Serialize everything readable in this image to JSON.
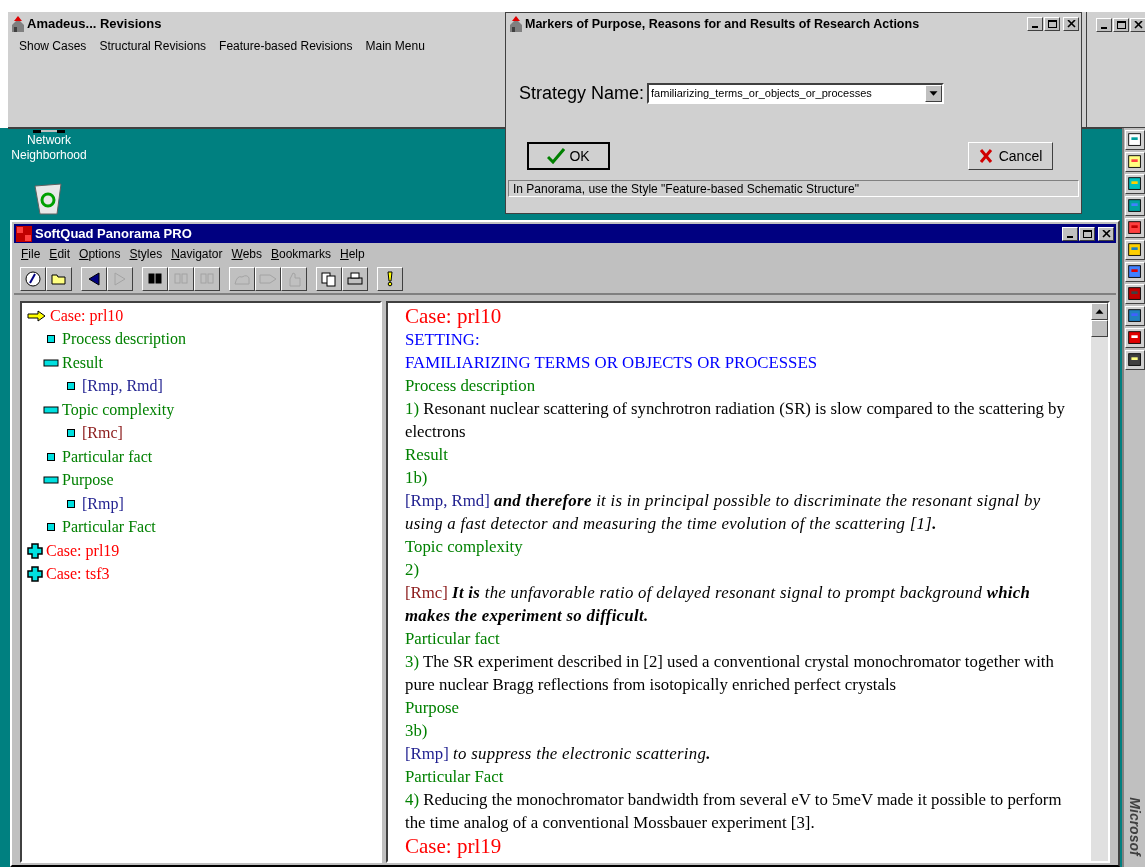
{
  "amadeus_window": {
    "title": "Amadeus... Revisions",
    "menu": [
      "Show Cases",
      "Structural Revisions",
      "Feature-based Revisions",
      "Main Menu"
    ]
  },
  "dialog": {
    "title": "Markers of Purpose, Reasons for and Results of Research Actions",
    "label": "Strategy Name:",
    "value": "familiarizing_terms_or_objects_or_processes",
    "ok": "OK",
    "cancel": "Cancel",
    "status": "In Panorama, use the Style \"Feature-based Schematic Structure\""
  },
  "desktop_icons": [
    {
      "label": "Network Neighborhood",
      "kind": "network"
    },
    {
      "kind": "recycle"
    }
  ],
  "side_bar_text": "Microsof",
  "panorama": {
    "title": "SoftQuad Panorama PRO",
    "menu": [
      "File",
      "Edit",
      "Options",
      "Styles",
      "Navigator",
      "Webs",
      "Bookmarks",
      "Help"
    ],
    "toolbar": [
      [
        {
          "kind": "help",
          "disabled": false
        },
        {
          "kind": "open",
          "disabled": false
        }
      ],
      [
        {
          "kind": "back",
          "disabled": false
        },
        {
          "kind": "forward",
          "disabled": true
        }
      ],
      [
        {
          "kind": "find",
          "disabled": false
        },
        {
          "kind": "find-prev",
          "disabled": true
        },
        {
          "kind": "find-next",
          "disabled": true
        }
      ],
      [
        {
          "kind": "web",
          "disabled": true
        },
        {
          "kind": "point",
          "disabled": true
        },
        {
          "kind": "thumb",
          "disabled": true
        }
      ],
      [
        {
          "kind": "copy",
          "disabled": false
        },
        {
          "kind": "print",
          "disabled": false
        }
      ],
      [
        {
          "kind": "alert",
          "disabled": false
        }
      ]
    ],
    "tree": [
      {
        "label": "Case: prl10",
        "kind": "case",
        "current": true,
        "expanded": true,
        "children": [
          {
            "label": "Process description",
            "kind": "section"
          },
          {
            "label": "Result",
            "kind": "section",
            "expanded": true,
            "children": [
              {
                "label": "[Rmp, Rmd]",
                "kind": "ref",
                "color": "#1f1f8f"
              }
            ]
          },
          {
            "label": "Topic complexity",
            "kind": "section",
            "expanded": true,
            "children": [
              {
                "label": "[Rmc]",
                "kind": "ref",
                "color": "#8b1a1a"
              }
            ]
          },
          {
            "label": "Particular fact",
            "kind": "section"
          },
          {
            "label": "Purpose",
            "kind": "section",
            "expanded": true,
            "children": [
              {
                "label": "[Rmp]",
                "kind": "ref",
                "color": "#1f1f8f"
              }
            ]
          },
          {
            "label": "Particular Fact",
            "kind": "section"
          }
        ]
      },
      {
        "label": "Case: prl19",
        "kind": "case",
        "current": false,
        "expanded": false
      },
      {
        "label": "Case: tsf3",
        "kind": "case",
        "current": false,
        "expanded": false
      }
    ],
    "document": [
      {
        "kind": "case",
        "text": "Case: prl10"
      },
      {
        "kind": "setting",
        "text": "SETTING:"
      },
      {
        "kind": "setting",
        "text": "FAMILIARIZING TERMS OR OBJECTS OR PROCESSES"
      },
      {
        "kind": "heading",
        "text": "Process description"
      },
      {
        "kind": "body",
        "marker": "1)",
        "color": "#008000",
        "text": "Resonant nuclear scattering of synchrotron radiation (SR) is slow compared to the scattering by electrons",
        "italic": false
      },
      {
        "kind": "heading",
        "text": "Result"
      },
      {
        "kind": "heading",
        "text": "1b)"
      },
      {
        "kind": "body",
        "marker": "[Rmp, Rmd]",
        "color": "#1f1f8f",
        "text": "**and therefore**  it is in principal possible to discriminate the resonant signal by using a fast detector and measuring the time evolution of the scattering [1]**.**",
        "italic": true
      },
      {
        "kind": "heading",
        "text": "Topic complexity"
      },
      {
        "kind": "heading",
        "text": "2)"
      },
      {
        "kind": "body",
        "marker": "[Rmc]",
        "color": "#8b1a1a",
        "text": "**It is**  the unfavorable ratio of delayed resonant signal to prompt background **which makes the experiment so difficult.**",
        "italic": true
      },
      {
        "kind": "heading",
        "text": "Particular fact"
      },
      {
        "kind": "body",
        "marker": "3)",
        "color": "#008000",
        "text": "The SR experiment described in [2] used a conventional crystal monochromator together with pure nuclear Bragg reflections from isotopically enriched perfect crystals",
        "italic": false
      },
      {
        "kind": "heading",
        "text": "Purpose"
      },
      {
        "kind": "heading",
        "text": "3b)"
      },
      {
        "kind": "body",
        "marker": "[Rmp]",
        "color": "#1f1f8f",
        "text": "to suppress the electronic scattering**.**",
        "italic": true
      },
      {
        "kind": "heading",
        "text": "Particular Fact"
      },
      {
        "kind": "body",
        "marker": "4)",
        "color": "#008000",
        "text": "Reducing the monochromator bandwidth from several eV to 5meV made it possible to perform the time analog of a conventional Mossbauer experiment [3].",
        "italic": false
      },
      {
        "kind": "case",
        "text": "Case: prl19"
      }
    ]
  }
}
